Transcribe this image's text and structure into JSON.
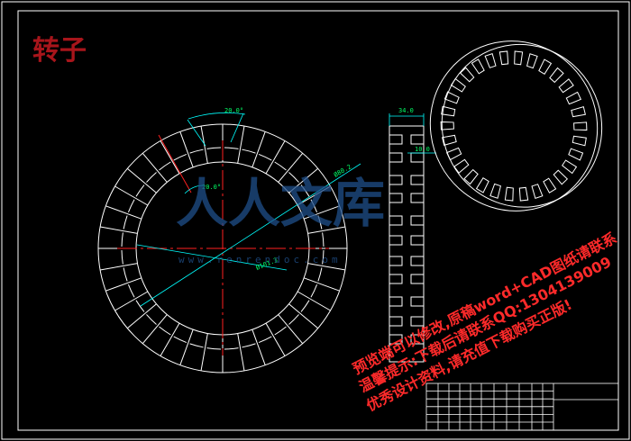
{
  "drawing": {
    "title": "转子"
  },
  "dimensions": {
    "angle_outer": "20.0°",
    "angle_inner": "20.0°",
    "diam_outer": "Ø80.2",
    "diam_inner": "Ø101.3",
    "width_top": "34.0",
    "width_right": "10.0"
  },
  "watermark": {
    "main": "人人文库",
    "url": "www.renrendoc.com"
  },
  "notice": {
    "line1": "预览端可以修改,原稿word+CAD图纸请联系",
    "line2": "温馨提示:下载后请联系QQ:1304139009",
    "line3": "优秀设计资料,请充值下载购买正版!"
  },
  "colors": {
    "background": "#000000",
    "geometry": "#ffffff",
    "centerline": "#ff2020",
    "dimension_line": "#00ffff",
    "dimension_text": "#00ff66",
    "title": "#a8151b"
  }
}
